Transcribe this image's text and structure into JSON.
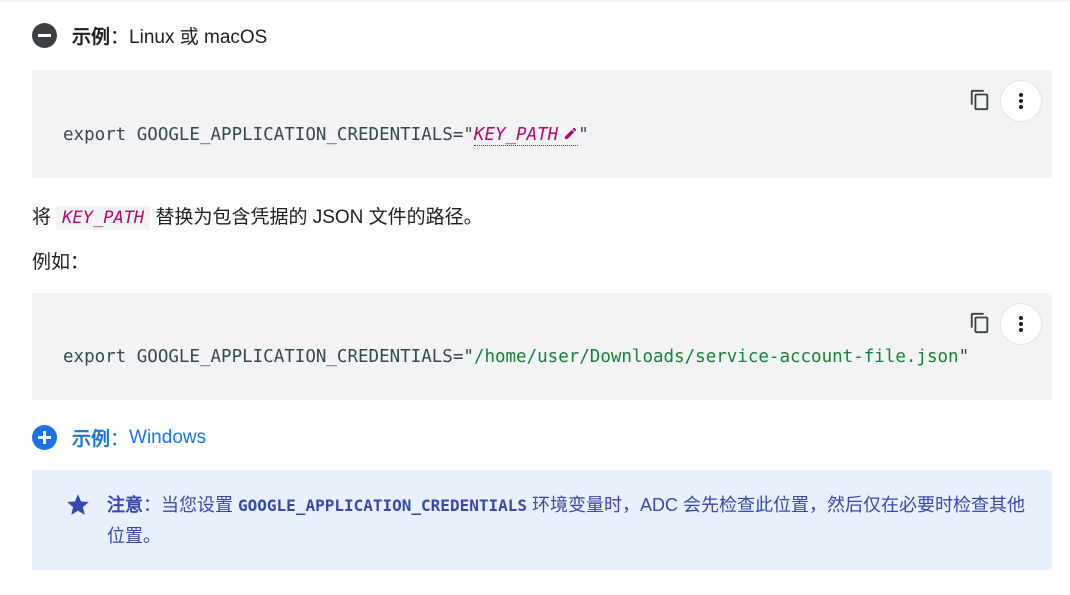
{
  "colors": {
    "code_bg": "#f1f3f4",
    "placeholder": "#b80672",
    "string": "#188038",
    "link_blue": "#1a73e8",
    "note_bg": "#e8f0fe",
    "note_text": "#3949ab",
    "collapse_icon_bg": "#3c4043"
  },
  "example_linux": {
    "icon": "minus-circle-icon",
    "label_bold": "示例",
    "label_sep": "：",
    "label_rest": "Linux 或 macOS"
  },
  "code1": {
    "prefix": "export GOOGLE_APPLICATION_CREDENTIALS=\"",
    "placeholder": "KEY_PATH",
    "suffix": "\"",
    "edit_icon": "pencil-icon",
    "copy_icon": "copy-icon",
    "more_icon": "more-vert-icon"
  },
  "para1": {
    "before": "将 ",
    "code": "KEY_PATH",
    "after": " 替换为包含凭据的 JSON 文件的路径。"
  },
  "para2": "例如：",
  "code2": {
    "prefix": "export GOOGLE_APPLICATION_CREDENTIALS=\"",
    "value": "/home/user/Downloads/service-account-file.json",
    "suffix": "\"",
    "copy_icon": "copy-icon",
    "more_icon": "more-vert-icon"
  },
  "example_windows": {
    "icon": "plus-circle-icon",
    "label_bold": "示例",
    "label_sep": "：",
    "label_rest": "Windows"
  },
  "note": {
    "icon": "star-icon",
    "label": "注意",
    "sep": "：",
    "text1": "当您设置 ",
    "code": "GOOGLE_APPLICATION_CREDENTIALS",
    "text2": " 环境变量时，ADC 会先检查此位置，然后仅在必要时检查其他位置。"
  }
}
